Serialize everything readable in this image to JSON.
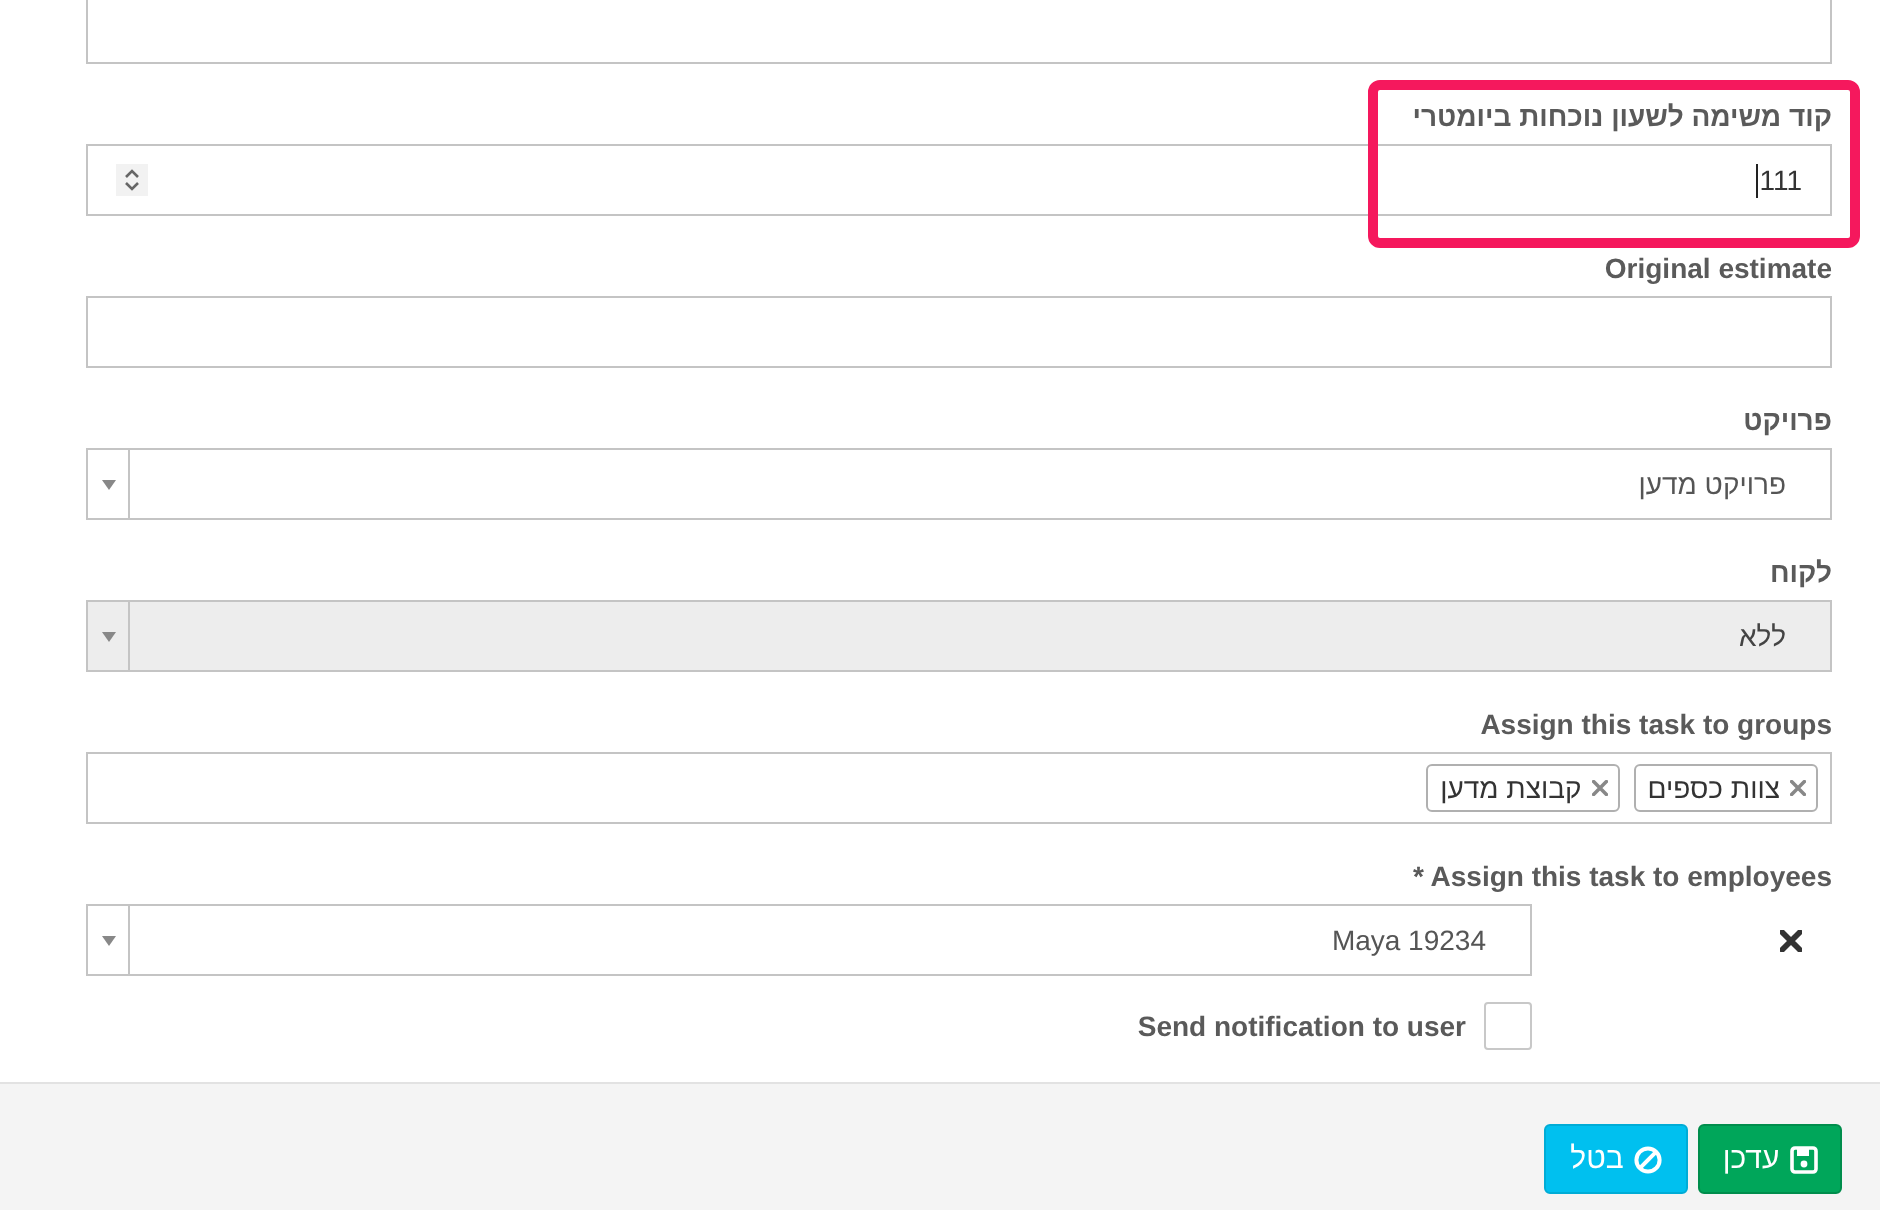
{
  "fields": [
    {
      "kind": "text"
    },
    {
      "kind": "number",
      "label": "קוד משימה לשעון נוכחות ביומטרי",
      "value": "111",
      "focused": true,
      "highlighted": true
    },
    {
      "kind": "text",
      "label": "Original estimate"
    },
    {
      "kind": "select",
      "label": "פרויקט",
      "value": "פרויקט מדען",
      "disabled": false
    },
    {
      "kind": "select",
      "label": "לקוח",
      "value": "ללא",
      "disabled": true
    },
    {
      "kind": "tags",
      "label": "Assign this task to groups",
      "tags": [
        "צוות כספים",
        "קבוצת מדען"
      ]
    },
    {
      "kind": "select",
      "label": "* Assign this task to employees",
      "value": "Maya 19234",
      "disabled": false,
      "clearable": true
    },
    {
      "kind": "checkbox",
      "label": "Send notification to user",
      "checked": false
    }
  ],
  "buttons": [
    {
      "kind": "save",
      "label": "עדכן"
    },
    {
      "kind": "cancel",
      "label": "בטל"
    }
  ]
}
